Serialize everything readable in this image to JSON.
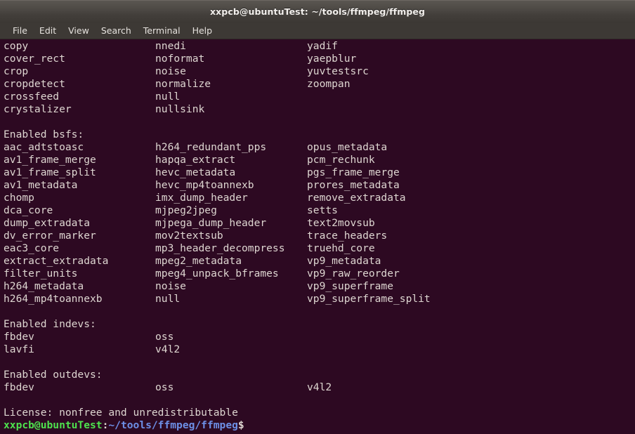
{
  "window": {
    "title": "xxpcb@ubuntuTest: ~/tools/ffmpeg/ffmpeg"
  },
  "menubar": {
    "items": [
      {
        "label": "File"
      },
      {
        "label": "Edit"
      },
      {
        "label": "View"
      },
      {
        "label": "Search"
      },
      {
        "label": "Terminal"
      },
      {
        "label": "Help"
      }
    ]
  },
  "colors": {
    "terminal_background": "#2d0922",
    "terminal_foreground": "#ded6d1",
    "titlebar_background": "#4b4743",
    "menubar_background": "#3d3935",
    "prompt_user_host": "#4ee24e",
    "prompt_path": "#6d8fe6"
  },
  "terminal": {
    "lines": [
      {
        "cols": [
          "copy",
          "nnedi",
          "yadif"
        ]
      },
      {
        "cols": [
          "cover_rect",
          "noformat",
          "yaepblur"
        ]
      },
      {
        "cols": [
          "crop",
          "noise",
          "yuvtestsrc"
        ]
      },
      {
        "cols": [
          "cropdetect",
          "normalize",
          "zoompan"
        ]
      },
      {
        "cols": [
          "crossfeed",
          "null",
          ""
        ]
      },
      {
        "cols": [
          "crystalizer",
          "nullsink",
          ""
        ]
      },
      {
        "cols": [
          "",
          "",
          ""
        ]
      },
      {
        "cols": [
          "Enabled bsfs:",
          "",
          ""
        ]
      },
      {
        "cols": [
          "aac_adtstoasc",
          "h264_redundant_pps",
          "opus_metadata"
        ]
      },
      {
        "cols": [
          "av1_frame_merge",
          "hapqa_extract",
          "pcm_rechunk"
        ]
      },
      {
        "cols": [
          "av1_frame_split",
          "hevc_metadata",
          "pgs_frame_merge"
        ]
      },
      {
        "cols": [
          "av1_metadata",
          "hevc_mp4toannexb",
          "prores_metadata"
        ]
      },
      {
        "cols": [
          "chomp",
          "imx_dump_header",
          "remove_extradata"
        ]
      },
      {
        "cols": [
          "dca_core",
          "mjpeg2jpeg",
          "setts"
        ]
      },
      {
        "cols": [
          "dump_extradata",
          "mjpega_dump_header",
          "text2movsub"
        ]
      },
      {
        "cols": [
          "dv_error_marker",
          "mov2textsub",
          "trace_headers"
        ]
      },
      {
        "cols": [
          "eac3_core",
          "mp3_header_decompress",
          "truehd_core"
        ]
      },
      {
        "cols": [
          "extract_extradata",
          "mpeg2_metadata",
          "vp9_metadata"
        ]
      },
      {
        "cols": [
          "filter_units",
          "mpeg4_unpack_bframes",
          "vp9_raw_reorder"
        ]
      },
      {
        "cols": [
          "h264_metadata",
          "noise",
          "vp9_superframe"
        ]
      },
      {
        "cols": [
          "h264_mp4toannexb",
          "null",
          "vp9_superframe_split"
        ]
      },
      {
        "cols": [
          "",
          "",
          ""
        ]
      },
      {
        "cols": [
          "Enabled indevs:",
          "",
          ""
        ]
      },
      {
        "cols": [
          "fbdev",
          "oss",
          ""
        ]
      },
      {
        "cols": [
          "lavfi",
          "v4l2",
          ""
        ]
      },
      {
        "cols": [
          "",
          "",
          ""
        ]
      },
      {
        "cols": [
          "Enabled outdevs:",
          "",
          ""
        ]
      },
      {
        "cols": [
          "fbdev",
          "oss",
          "v4l2"
        ]
      },
      {
        "cols": [
          "",
          "",
          ""
        ]
      },
      {
        "cols": [
          "License: nonfree and unredistributable",
          "",
          ""
        ]
      }
    ],
    "prompt": {
      "user_host": "xxpcb@ubuntuTest",
      "separator": ":",
      "path": "~/tools/ffmpeg/ffmpeg",
      "symbol": "$",
      "input": ""
    }
  }
}
